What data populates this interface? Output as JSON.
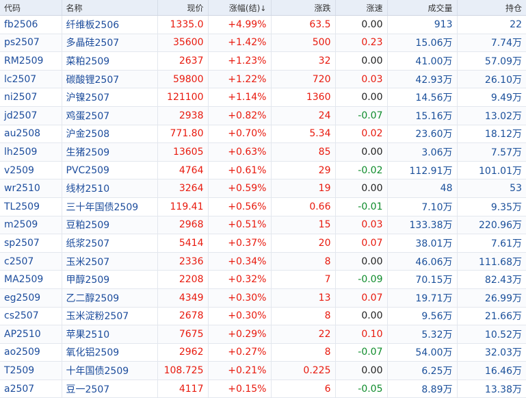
{
  "headers": {
    "code": "代码",
    "name": "名称",
    "price": "现价",
    "change_pct": "涨幅(结)",
    "change": "涨跌",
    "speed": "涨速",
    "volume": "成交量",
    "open_interest": "持仓"
  },
  "sort_icon": "↓",
  "colors": {
    "up": "#e8190d",
    "down": "#0f8c2c",
    "link": "#1c4c9c",
    "header_bg": "#e8eef7"
  },
  "rows": [
    {
      "code": "fb2506",
      "name": "纤维板2506",
      "price": "1335.0",
      "change_pct": "+4.99%",
      "change": "63.5",
      "speed": "0.00",
      "speed_dir": "flat",
      "volume": "913",
      "open_interest": "22"
    },
    {
      "code": "ps2507",
      "name": "多晶硅2507",
      "price": "35600",
      "change_pct": "+1.42%",
      "change": "500",
      "speed": "0.23",
      "speed_dir": "up",
      "volume": "15.06万",
      "open_interest": "7.74万"
    },
    {
      "code": "RM2509",
      "name": "菜粕2509",
      "price": "2637",
      "change_pct": "+1.23%",
      "change": "32",
      "speed": "0.00",
      "speed_dir": "flat",
      "volume": "41.00万",
      "open_interest": "57.09万"
    },
    {
      "code": "lc2507",
      "name": "碳酸锂2507",
      "price": "59800",
      "change_pct": "+1.22%",
      "change": "720",
      "speed": "0.03",
      "speed_dir": "up",
      "volume": "42.93万",
      "open_interest": "26.10万"
    },
    {
      "code": "ni2507",
      "name": "沪镍2507",
      "price": "121100",
      "change_pct": "+1.14%",
      "change": "1360",
      "speed": "0.00",
      "speed_dir": "flat",
      "volume": "14.56万",
      "open_interest": "9.49万"
    },
    {
      "code": "jd2507",
      "name": "鸡蛋2507",
      "price": "2938",
      "change_pct": "+0.82%",
      "change": "24",
      "speed": "-0.07",
      "speed_dir": "down",
      "volume": "15.16万",
      "open_interest": "13.02万"
    },
    {
      "code": "au2508",
      "name": "沪金2508",
      "price": "771.80",
      "change_pct": "+0.70%",
      "change": "5.34",
      "speed": "0.02",
      "speed_dir": "up",
      "volume": "23.60万",
      "open_interest": "18.12万"
    },
    {
      "code": "lh2509",
      "name": "生猪2509",
      "price": "13605",
      "change_pct": "+0.63%",
      "change": "85",
      "speed": "0.00",
      "speed_dir": "flat",
      "volume": "3.06万",
      "open_interest": "7.57万"
    },
    {
      "code": "v2509",
      "name": "PVC2509",
      "price": "4764",
      "change_pct": "+0.61%",
      "change": "29",
      "speed": "-0.02",
      "speed_dir": "down",
      "volume": "112.91万",
      "open_interest": "101.01万"
    },
    {
      "code": "wr2510",
      "name": "线材2510",
      "price": "3264",
      "change_pct": "+0.59%",
      "change": "19",
      "speed": "0.00",
      "speed_dir": "flat",
      "volume": "48",
      "open_interest": "53"
    },
    {
      "code": "TL2509",
      "name": "三十年国债2509",
      "price": "119.41",
      "change_pct": "+0.56%",
      "change": "0.66",
      "speed": "-0.01",
      "speed_dir": "down",
      "volume": "7.10万",
      "open_interest": "9.35万"
    },
    {
      "code": "m2509",
      "name": "豆粕2509",
      "price": "2968",
      "change_pct": "+0.51%",
      "change": "15",
      "speed": "0.03",
      "speed_dir": "up",
      "volume": "133.38万",
      "open_interest": "220.96万"
    },
    {
      "code": "sp2507",
      "name": "纸浆2507",
      "price": "5414",
      "change_pct": "+0.37%",
      "change": "20",
      "speed": "0.07",
      "speed_dir": "up",
      "volume": "38.01万",
      "open_interest": "7.61万"
    },
    {
      "code": "c2507",
      "name": "玉米2507",
      "price": "2336",
      "change_pct": "+0.34%",
      "change": "8",
      "speed": "0.00",
      "speed_dir": "flat",
      "volume": "46.06万",
      "open_interest": "111.68万"
    },
    {
      "code": "MA2509",
      "name": "甲醇2509",
      "price": "2208",
      "change_pct": "+0.32%",
      "change": "7",
      "speed": "-0.09",
      "speed_dir": "down",
      "volume": "70.15万",
      "open_interest": "82.43万"
    },
    {
      "code": "eg2509",
      "name": "乙二醇2509",
      "price": "4349",
      "change_pct": "+0.30%",
      "change": "13",
      "speed": "0.07",
      "speed_dir": "up",
      "volume": "19.71万",
      "open_interest": "26.99万"
    },
    {
      "code": "cs2507",
      "name": "玉米淀粉2507",
      "price": "2678",
      "change_pct": "+0.30%",
      "change": "8",
      "speed": "0.00",
      "speed_dir": "flat",
      "volume": "9.56万",
      "open_interest": "21.66万"
    },
    {
      "code": "AP2510",
      "name": "苹果2510",
      "price": "7675",
      "change_pct": "+0.29%",
      "change": "22",
      "speed": "0.10",
      "speed_dir": "up",
      "volume": "5.32万",
      "open_interest": "10.52万"
    },
    {
      "code": "ao2509",
      "name": "氧化铝2509",
      "price": "2962",
      "change_pct": "+0.27%",
      "change": "8",
      "speed": "-0.07",
      "speed_dir": "down",
      "volume": "54.00万",
      "open_interest": "32.03万"
    },
    {
      "code": "T2509",
      "name": "十年国债2509",
      "price": "108.725",
      "change_pct": "+0.21%",
      "change": "0.225",
      "speed": "0.00",
      "speed_dir": "flat",
      "volume": "6.25万",
      "open_interest": "16.46万"
    },
    {
      "code": "a2507",
      "name": "豆一2507",
      "price": "4117",
      "change_pct": "+0.15%",
      "change": "6",
      "speed": "-0.05",
      "speed_dir": "down",
      "volume": "8.89万",
      "open_interest": "13.38万"
    }
  ]
}
